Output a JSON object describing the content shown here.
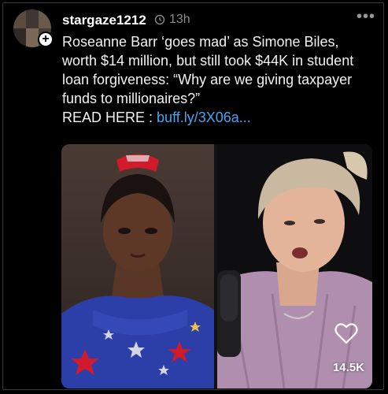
{
  "post": {
    "username": "stargaze1212",
    "time": "13h",
    "caption_text": "Roseanne Barr ‘goes mad’ as Simone Biles, worth $14 million, but still took $44K in student loan forgiveness: “Why are we giving taxpayer funds to millionaires?”",
    "read_label": "READ HERE :",
    "link_text": "buff.ly/3X06a...",
    "like_count": "14.5K"
  },
  "icons": {
    "avatar": "avatar-collage",
    "follow": "plus-icon",
    "time": "clock-icon",
    "more": "ellipsis-icon",
    "like": "heart-icon"
  },
  "colors": {
    "background": "#000000",
    "link": "#4aa3f0",
    "meta": "#8a8a8a"
  }
}
